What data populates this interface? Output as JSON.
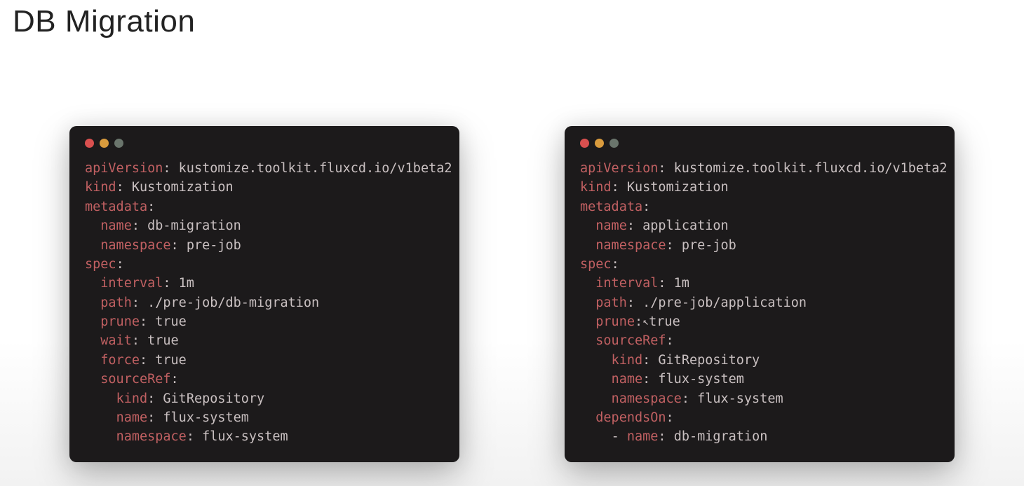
{
  "title": "DB Migration",
  "cursor_glyph": "↖",
  "left": {
    "apiVersion_key": "apiVersion",
    "apiVersion_val": "kustomize.toolkit.fluxcd.io/v1beta2",
    "kind_key": "kind",
    "kind_val": "Kustomization",
    "metadata_key": "metadata",
    "metadata_name_key": "name",
    "metadata_name_val": "db-migration",
    "metadata_namespace_key": "namespace",
    "metadata_namespace_val": "pre-job",
    "spec_key": "spec",
    "interval_key": "interval",
    "interval_val": "1m",
    "path_key": "path",
    "path_val": "./pre-job/db-migration",
    "prune_key": "prune",
    "prune_val": "true",
    "wait_key": "wait",
    "wait_val": "true",
    "force_key": "force",
    "force_val": "true",
    "sourceRef_key": "sourceRef",
    "src_kind_key": "kind",
    "src_kind_val": "GitRepository",
    "src_name_key": "name",
    "src_name_val": "flux-system",
    "src_namespace_key": "namespace",
    "src_namespace_val": "flux-system"
  },
  "right": {
    "apiVersion_key": "apiVersion",
    "apiVersion_val": "kustomize.toolkit.fluxcd.io/v1beta2",
    "kind_key": "kind",
    "kind_val": "Kustomization",
    "metadata_key": "metadata",
    "metadata_name_key": "name",
    "metadata_name_val": "application",
    "metadata_namespace_key": "namespace",
    "metadata_namespace_val": "pre-job",
    "spec_key": "spec",
    "interval_key": "interval",
    "interval_val": "1m",
    "path_key": "path",
    "path_val": "./pre-job/application",
    "prune_key": "prune",
    "prune_val": "true",
    "sourceRef_key": "sourceRef",
    "src_kind_key": "kind",
    "src_kind_val": "GitRepository",
    "src_name_key": "name",
    "src_name_val": "flux-system",
    "src_namespace_key": "namespace",
    "src_namespace_val": "flux-system",
    "dependsOn_key": "dependsOn",
    "depends_item_prefix": "- ",
    "depends_name_key": "name",
    "depends_name_val": "db-migration"
  }
}
